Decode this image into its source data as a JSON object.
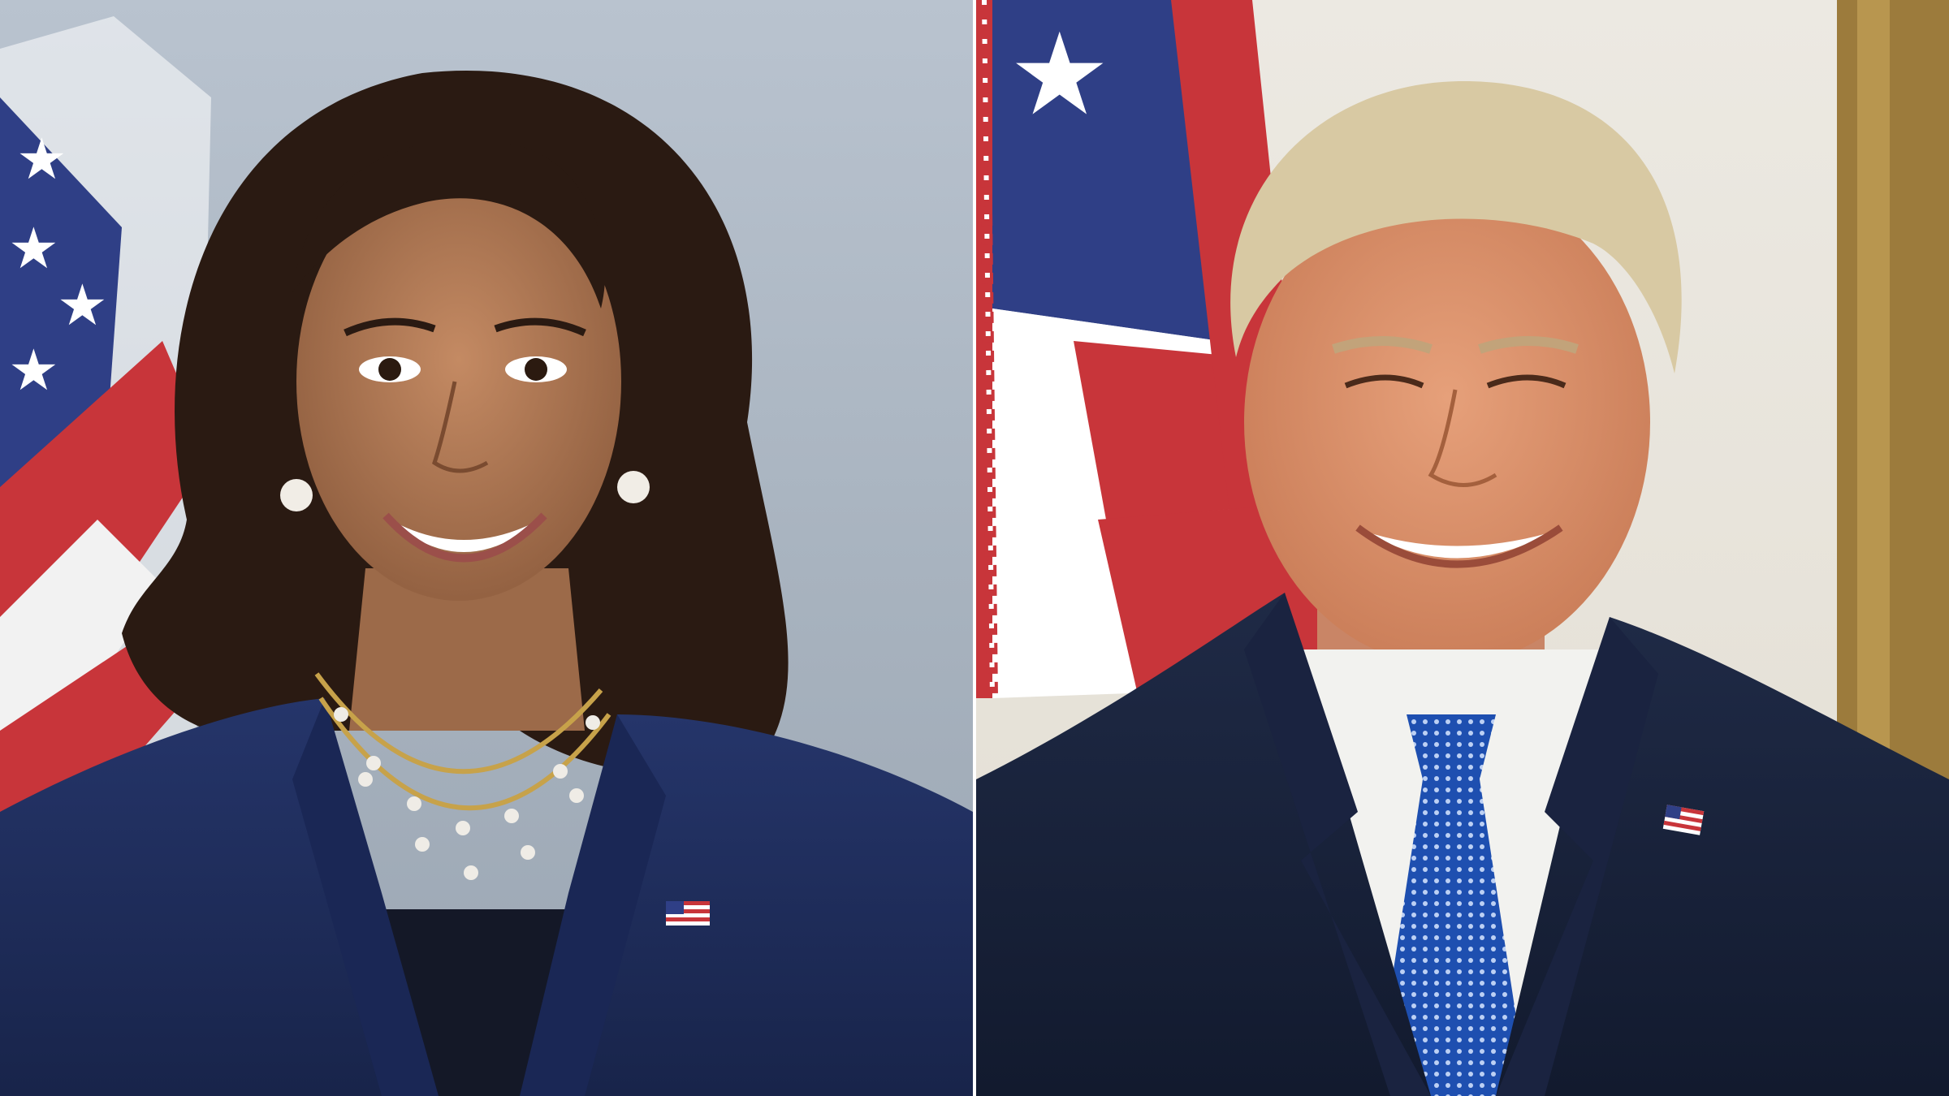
{
  "layout": {
    "panels": [
      {
        "name": "left-portrait",
        "subject": "woman-in-navy-suit",
        "background": "grey-studio-with-flag",
        "colors": {
          "suit": "#1f2d5a",
          "hair": "#2a1a12",
          "skin": "#b07a55",
          "backdrop": "#aeb8c4"
        }
      },
      {
        "name": "right-portrait",
        "subject": "man-in-navy-suit-blue-tie",
        "background": "white-wall-with-flag",
        "colors": {
          "suit": "#1a2238",
          "hair": "#d8c9a3",
          "skin": "#d98f68",
          "tie": "#1e4fb0",
          "backdrop": "#e6e1d6"
        }
      }
    ],
    "divider_color": "#ffffff"
  },
  "icons": [
    "us-flag-icon",
    "flag-lapel-pin-icon"
  ]
}
